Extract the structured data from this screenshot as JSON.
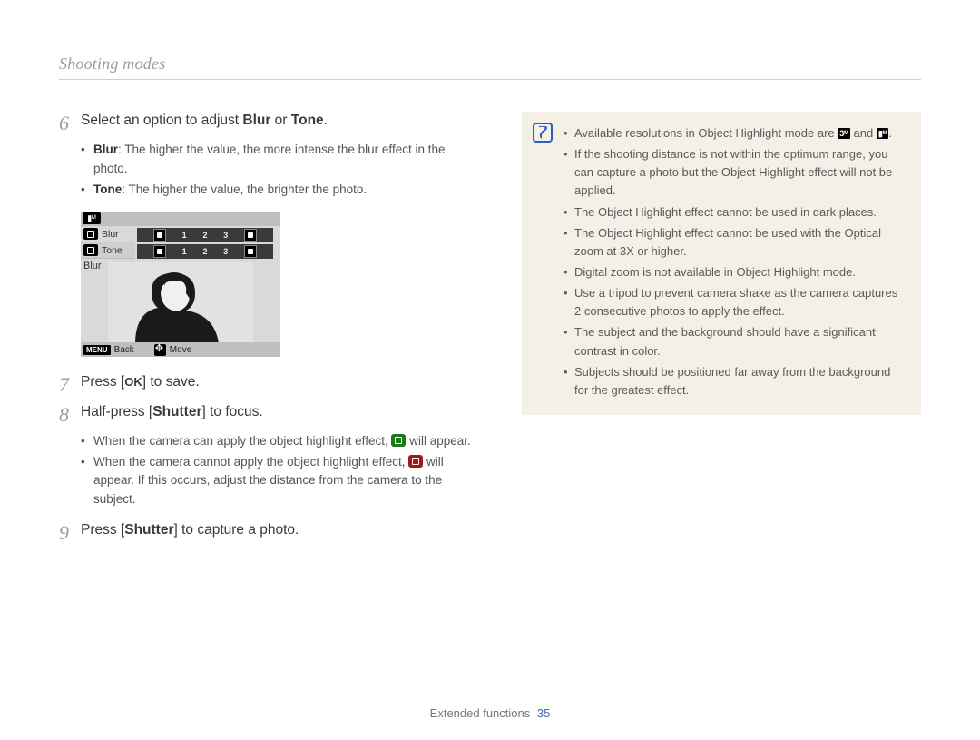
{
  "header": {
    "title": "Shooting modes"
  },
  "steps": {
    "s6": {
      "num": "6",
      "text_pre": "Select an option to adjust ",
      "bold1": "Blur",
      "mid": " or ",
      "bold2": "Tone",
      "suffix": ".",
      "bullets": [
        {
          "label": "Blur",
          "text": ": The higher the value, the more intense the blur effect in the photo."
        },
        {
          "label": "Tone",
          "text": ": The higher the value, the brighter the photo."
        }
      ]
    },
    "s7": {
      "num": "7",
      "pre": "Press [",
      "ok": "OK",
      "post": "] to save."
    },
    "s8": {
      "num": "8",
      "pre": "Half-press [",
      "bold": "Shutter",
      "post": "] to focus.",
      "bullets": [
        {
          "pre": "When the camera can apply the object highlight effect, ",
          "post": " will appear.",
          "badge": "green"
        },
        {
          "pre": "When the camera cannot apply the object highlight effect, ",
          "post": " will appear. If this occurs, adjust the distance from the camera to the subject.",
          "badge": "red"
        }
      ]
    },
    "s9": {
      "num": "9",
      "pre": "Press [",
      "bold": "Shutter",
      "post": "] to capture a photo."
    }
  },
  "lcd": {
    "topicon": "▮ᴹ",
    "rows": [
      "Blur",
      "Tone"
    ],
    "label": "Blur",
    "ticks": [
      "1",
      "2",
      "3"
    ],
    "bottom": {
      "menu": "MENU",
      "back": "Back",
      "move": "Move"
    }
  },
  "note": {
    "items": [
      {
        "pre": "Available resolutions in Object Highlight mode are ",
        "chip1": "3ᴹ",
        "mid": " and ",
        "chip2": "▮ᴹ",
        "post": "."
      },
      {
        "text": "If the shooting distance is not within the optimum range, you can capture a photo but the Object Highlight effect will not be applied."
      },
      {
        "text": "The Object Highlight effect cannot be used in dark places."
      },
      {
        "text": "The Object Highlight effect cannot be used with the Optical zoom at 3X or higher."
      },
      {
        "text": "Digital zoom is not available in Object Highlight mode."
      },
      {
        "text": "Use a tripod to prevent camera shake as the camera captures 2 consecutive photos to apply the effect."
      },
      {
        "text": "The subject and the background should have a significant contrast in color."
      },
      {
        "text": "Subjects should be positioned far away from the background for the greatest effect."
      }
    ]
  },
  "footer": {
    "section": "Extended functions",
    "page": "35"
  }
}
